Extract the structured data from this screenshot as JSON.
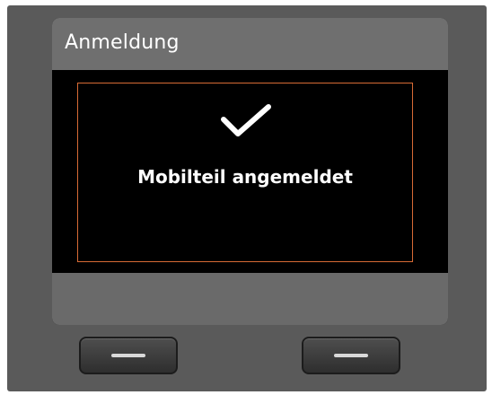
{
  "screen": {
    "title": "Anmeldung",
    "message": "Mobilteil angemeldet",
    "status_icon": "checkmark-icon",
    "highlight_color": "#d86b35"
  },
  "softkeys": {
    "left_icon": "dash-icon",
    "right_icon": "dash-icon"
  }
}
